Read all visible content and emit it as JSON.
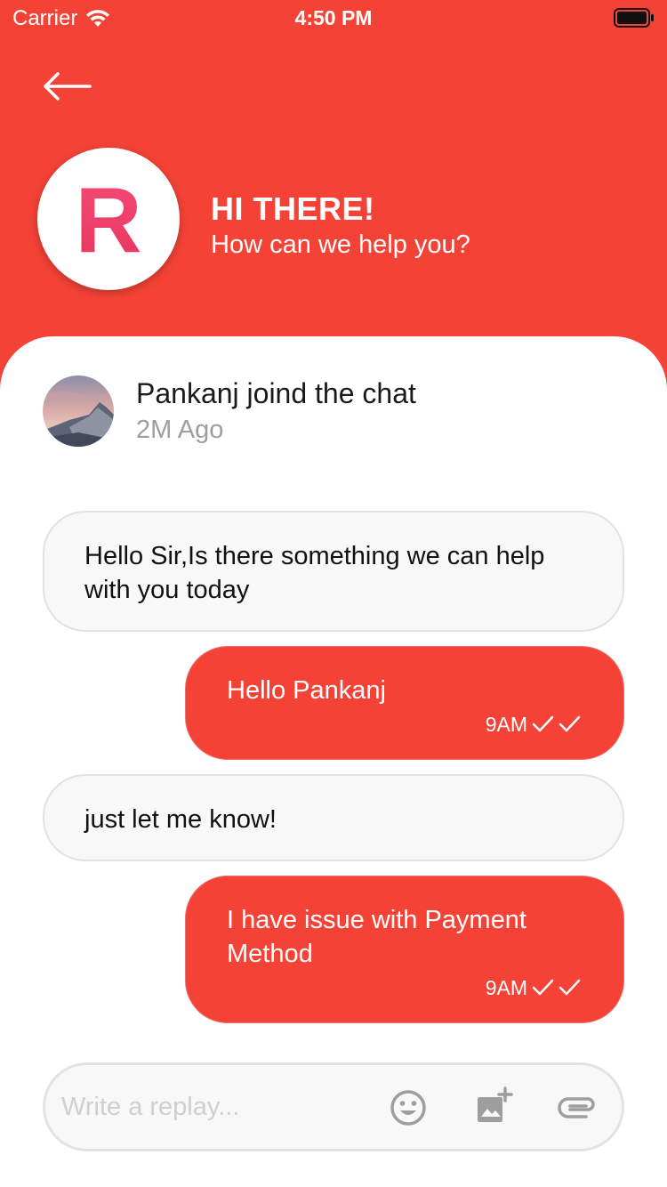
{
  "status_bar": {
    "carrier": "Carrier",
    "time": "4:50 PM"
  },
  "header": {
    "logo_letter": "R",
    "greeting": "HI THERE!",
    "subtitle": "How can we help you?"
  },
  "join": {
    "title": "Pankanj joind the chat",
    "time": "2M Ago"
  },
  "messages": [
    {
      "side": "incoming",
      "text": "Hello Sir,Is there something we can help with you today"
    },
    {
      "side": "outgoing",
      "text": "Hello Pankanj",
      "time": "9AM"
    },
    {
      "side": "incoming",
      "text": "just let me know!"
    },
    {
      "side": "outgoing",
      "text": "I have issue with Payment Method",
      "time": "9AM"
    }
  ],
  "composer": {
    "placeholder": "Write a replay...",
    "icons": [
      "emoji-icon",
      "add-photo-icon",
      "attachment-icon"
    ]
  },
  "colors": {
    "primary": "#F44336",
    "bubble_incoming": "#F8F8F8",
    "muted_text": "#9E9E9E"
  }
}
